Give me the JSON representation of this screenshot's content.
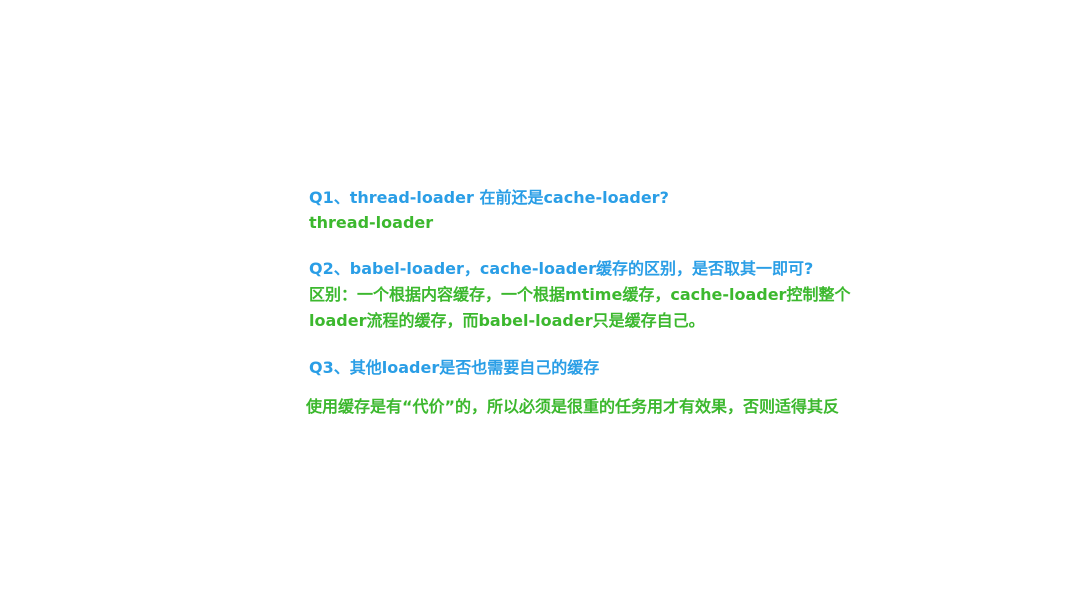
{
  "q1": {
    "question": "Q1、thread-loader 在前还是cache-loader?",
    "answer": "thread-loader"
  },
  "q2": {
    "question": "Q2、babel-loader，cache-loader缓存的区别，是否取其一即可?",
    "answer_line1": "区别：一个根据内容缓存，一个根据mtime缓存，cache-loader控制整个",
    "answer_line2": "loader流程的缓存，而babel-loader只是缓存自己。"
  },
  "q3": {
    "question": "Q3、其他loader是否也需要自己的缓存",
    "answer": "使用缓存是有“代价”的，所以必须是很重的任务用才有效果，否则适得其反"
  },
  "colors": {
    "question": "#2a9ee6",
    "answer": "#3cb82e",
    "background": "#ffffff"
  }
}
